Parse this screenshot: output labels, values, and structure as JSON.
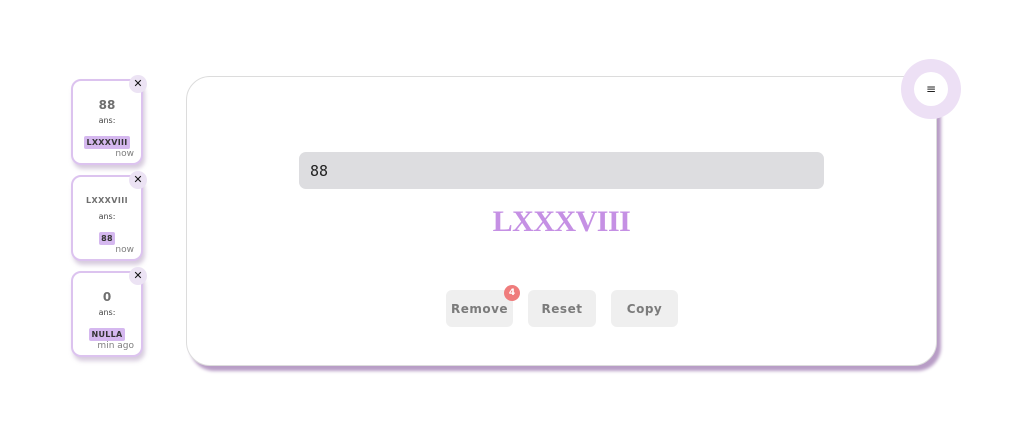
{
  "history": [
    {
      "query": "88",
      "ans_label": "ans:",
      "answer": "LXXXVIII",
      "time": "now"
    },
    {
      "query": "LXXXVIII",
      "ans_label": "ans:",
      "answer": "88",
      "time": "now"
    },
    {
      "query": "0",
      "ans_label": "ans:",
      "answer": "NULLA",
      "time": "min ago"
    }
  ],
  "close_glyph": "✕",
  "converter": {
    "input_value": "88",
    "result": "LXXXVIII"
  },
  "actions": {
    "remove_label": "Remove",
    "remove_badge": "4",
    "reset_label": "Reset",
    "copy_label": "Copy"
  },
  "menu": {
    "icon": "hamburger-icon",
    "glyph": "≡"
  },
  "colors": {
    "accent": "#c590e4",
    "chip": "#d5b8ef",
    "badge": "#ef7c7c",
    "input_bg": "#dddde0",
    "button_bg": "#efefef"
  }
}
